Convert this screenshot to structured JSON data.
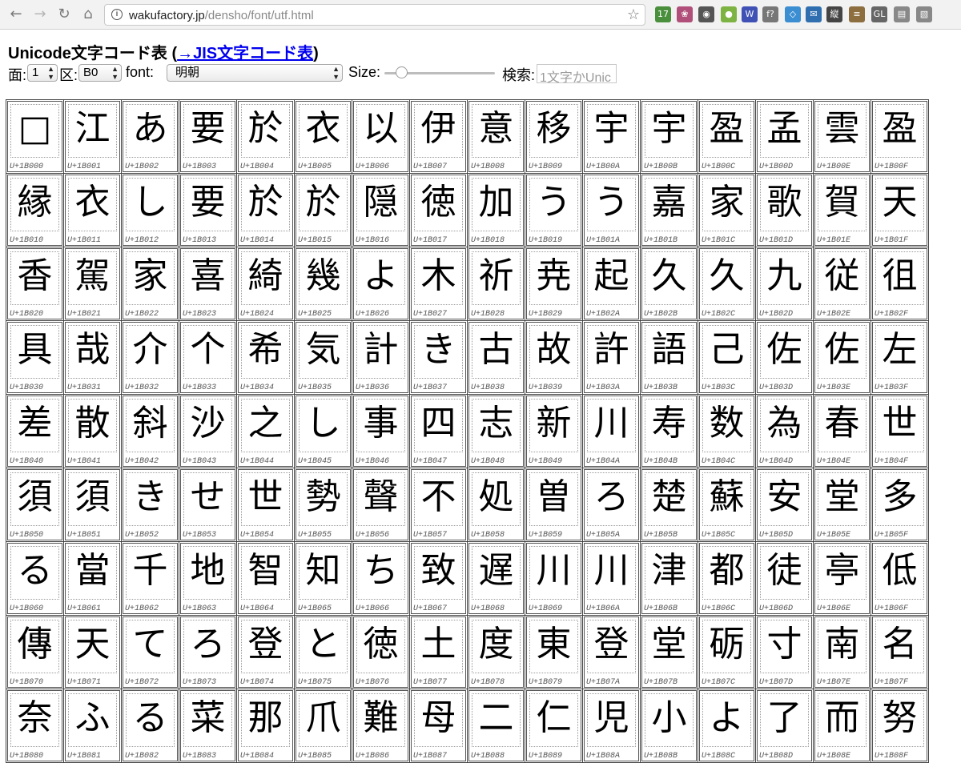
{
  "browser": {
    "url_host": "wakufactory.jp",
    "url_path": "/densho/font/utf.html",
    "back_icon": "←",
    "forward_icon": "→",
    "reload_icon": "↻",
    "home_icon": "⌂",
    "star_icon": "☆",
    "extensions": [
      {
        "name": "calendar-ext-icon",
        "glyph": "17",
        "color": "#4a8f3c"
      },
      {
        "name": "flower-ext-icon",
        "glyph": "❀",
        "color": "#b0507a"
      },
      {
        "name": "globe-ext-icon",
        "glyph": "◉",
        "color": "#555555"
      },
      {
        "name": "green-dot-ext-icon",
        "glyph": "●",
        "color": "#7cb342"
      },
      {
        "name": "we-ext-icon",
        "glyph": "W",
        "color": "#3f51b5"
      },
      {
        "name": "function-ext-icon",
        "glyph": "f?",
        "color": "#777777"
      },
      {
        "name": "diamond-ext-icon",
        "glyph": "◇",
        "color": "#3b8ed1"
      },
      {
        "name": "mail-ext-icon",
        "glyph": "✉",
        "color": "#2f6fb0"
      },
      {
        "name": "vertical-ext-icon",
        "glyph": "縦",
        "color": "#444444"
      },
      {
        "name": "page-ext-icon",
        "glyph": "≡",
        "color": "#8d6e3f"
      },
      {
        "name": "gl-ext-icon",
        "glyph": "GL",
        "color": "#666666"
      },
      {
        "name": "doc-ext-icon",
        "glyph": "▤",
        "color": "#888888"
      },
      {
        "name": "image-ext-icon",
        "glyph": "▧",
        "color": "#888888"
      }
    ]
  },
  "header": {
    "title": "Unicode文字コード表 (",
    "link": "→JIS文字コード表",
    "title_end": ")"
  },
  "controls": {
    "plane_label": "面:",
    "plane_value": "1",
    "block_label": "区:",
    "block_value": "B0",
    "font_label": "font:",
    "font_value": "明朝",
    "size_label": "Size:",
    "size_level": 0.1,
    "search_label": "検索:",
    "search_placeholder": "1文字かUnic"
  },
  "cells": [
    {
      "code": "U+1B000",
      "g": "□"
    },
    {
      "code": "U+1B001",
      "g": "江"
    },
    {
      "code": "U+1B002",
      "g": "あ"
    },
    {
      "code": "U+1B003",
      "g": "要"
    },
    {
      "code": "U+1B004",
      "g": "於"
    },
    {
      "code": "U+1B005",
      "g": "衣"
    },
    {
      "code": "U+1B006",
      "g": "以"
    },
    {
      "code": "U+1B007",
      "g": "伊"
    },
    {
      "code": "U+1B008",
      "g": "意"
    },
    {
      "code": "U+1B009",
      "g": "移"
    },
    {
      "code": "U+1B00A",
      "g": "宇"
    },
    {
      "code": "U+1B00B",
      "g": "宇"
    },
    {
      "code": "U+1B00C",
      "g": "盈"
    },
    {
      "code": "U+1B00D",
      "g": "孟"
    },
    {
      "code": "U+1B00E",
      "g": "雲"
    },
    {
      "code": "U+1B00F",
      "g": "盈"
    },
    {
      "code": "U+1B010",
      "g": "縁"
    },
    {
      "code": "U+1B011",
      "g": "衣"
    },
    {
      "code": "U+1B012",
      "g": "し"
    },
    {
      "code": "U+1B013",
      "g": "要"
    },
    {
      "code": "U+1B014",
      "g": "於"
    },
    {
      "code": "U+1B015",
      "g": "於"
    },
    {
      "code": "U+1B016",
      "g": "隠"
    },
    {
      "code": "U+1B017",
      "g": "徳"
    },
    {
      "code": "U+1B018",
      "g": "加"
    },
    {
      "code": "U+1B019",
      "g": "う"
    },
    {
      "code": "U+1B01A",
      "g": "う"
    },
    {
      "code": "U+1B01B",
      "g": "嘉"
    },
    {
      "code": "U+1B01C",
      "g": "家"
    },
    {
      "code": "U+1B01D",
      "g": "歌"
    },
    {
      "code": "U+1B01E",
      "g": "賀"
    },
    {
      "code": "U+1B01F",
      "g": "天"
    },
    {
      "code": "U+1B020",
      "g": "香"
    },
    {
      "code": "U+1B021",
      "g": "駕"
    },
    {
      "code": "U+1B022",
      "g": "家"
    },
    {
      "code": "U+1B023",
      "g": "喜"
    },
    {
      "code": "U+1B024",
      "g": "綺"
    },
    {
      "code": "U+1B025",
      "g": "幾"
    },
    {
      "code": "U+1B026",
      "g": "よ"
    },
    {
      "code": "U+1B027",
      "g": "木"
    },
    {
      "code": "U+1B028",
      "g": "祈"
    },
    {
      "code": "U+1B029",
      "g": "尭"
    },
    {
      "code": "U+1B02A",
      "g": "起"
    },
    {
      "code": "U+1B02B",
      "g": "久"
    },
    {
      "code": "U+1B02C",
      "g": "久"
    },
    {
      "code": "U+1B02D",
      "g": "九"
    },
    {
      "code": "U+1B02E",
      "g": "従"
    },
    {
      "code": "U+1B02F",
      "g": "徂"
    },
    {
      "code": "U+1B030",
      "g": "具"
    },
    {
      "code": "U+1B031",
      "g": "哉"
    },
    {
      "code": "U+1B032",
      "g": "介"
    },
    {
      "code": "U+1B033",
      "g": "个"
    },
    {
      "code": "U+1B034",
      "g": "希"
    },
    {
      "code": "U+1B035",
      "g": "気"
    },
    {
      "code": "U+1B036",
      "g": "計"
    },
    {
      "code": "U+1B037",
      "g": "き"
    },
    {
      "code": "U+1B038",
      "g": "古"
    },
    {
      "code": "U+1B039",
      "g": "故"
    },
    {
      "code": "U+1B03A",
      "g": "許"
    },
    {
      "code": "U+1B03B",
      "g": "語"
    },
    {
      "code": "U+1B03C",
      "g": "己"
    },
    {
      "code": "U+1B03D",
      "g": "佐"
    },
    {
      "code": "U+1B03E",
      "g": "佐"
    },
    {
      "code": "U+1B03F",
      "g": "左"
    },
    {
      "code": "U+1B040",
      "g": "差"
    },
    {
      "code": "U+1B041",
      "g": "散"
    },
    {
      "code": "U+1B042",
      "g": "斜"
    },
    {
      "code": "U+1B043",
      "g": "沙"
    },
    {
      "code": "U+1B044",
      "g": "之"
    },
    {
      "code": "U+1B045",
      "g": "し"
    },
    {
      "code": "U+1B046",
      "g": "事"
    },
    {
      "code": "U+1B047",
      "g": "四"
    },
    {
      "code": "U+1B048",
      "g": "志"
    },
    {
      "code": "U+1B049",
      "g": "新"
    },
    {
      "code": "U+1B04A",
      "g": "川"
    },
    {
      "code": "U+1B04B",
      "g": "寿"
    },
    {
      "code": "U+1B04C",
      "g": "数"
    },
    {
      "code": "U+1B04D",
      "g": "為"
    },
    {
      "code": "U+1B04E",
      "g": "春"
    },
    {
      "code": "U+1B04F",
      "g": "世"
    },
    {
      "code": "U+1B050",
      "g": "須"
    },
    {
      "code": "U+1B051",
      "g": "須"
    },
    {
      "code": "U+1B052",
      "g": "き"
    },
    {
      "code": "U+1B053",
      "g": "せ"
    },
    {
      "code": "U+1B054",
      "g": "世"
    },
    {
      "code": "U+1B055",
      "g": "勢"
    },
    {
      "code": "U+1B056",
      "g": "聲"
    },
    {
      "code": "U+1B057",
      "g": "不"
    },
    {
      "code": "U+1B058",
      "g": "処"
    },
    {
      "code": "U+1B059",
      "g": "曽"
    },
    {
      "code": "U+1B05A",
      "g": "ろ"
    },
    {
      "code": "U+1B05B",
      "g": "楚"
    },
    {
      "code": "U+1B05C",
      "g": "蘇"
    },
    {
      "code": "U+1B05D",
      "g": "安"
    },
    {
      "code": "U+1B05E",
      "g": "堂"
    },
    {
      "code": "U+1B05F",
      "g": "多"
    },
    {
      "code": "U+1B060",
      "g": "る"
    },
    {
      "code": "U+1B061",
      "g": "當"
    },
    {
      "code": "U+1B062",
      "g": "千"
    },
    {
      "code": "U+1B063",
      "g": "地"
    },
    {
      "code": "U+1B064",
      "g": "智"
    },
    {
      "code": "U+1B065",
      "g": "知"
    },
    {
      "code": "U+1B066",
      "g": "ち"
    },
    {
      "code": "U+1B067",
      "g": "致"
    },
    {
      "code": "U+1B068",
      "g": "遅"
    },
    {
      "code": "U+1B069",
      "g": "川"
    },
    {
      "code": "U+1B06A",
      "g": "川"
    },
    {
      "code": "U+1B06B",
      "g": "津"
    },
    {
      "code": "U+1B06C",
      "g": "都"
    },
    {
      "code": "U+1B06D",
      "g": "徒"
    },
    {
      "code": "U+1B06E",
      "g": "亭"
    },
    {
      "code": "U+1B06F",
      "g": "低"
    },
    {
      "code": "U+1B070",
      "g": "傳"
    },
    {
      "code": "U+1B071",
      "g": "天"
    },
    {
      "code": "U+1B072",
      "g": "て"
    },
    {
      "code": "U+1B073",
      "g": "ろ"
    },
    {
      "code": "U+1B074",
      "g": "登"
    },
    {
      "code": "U+1B075",
      "g": "と"
    },
    {
      "code": "U+1B076",
      "g": "徳"
    },
    {
      "code": "U+1B077",
      "g": "土"
    },
    {
      "code": "U+1B078",
      "g": "度"
    },
    {
      "code": "U+1B079",
      "g": "東"
    },
    {
      "code": "U+1B07A",
      "g": "登"
    },
    {
      "code": "U+1B07B",
      "g": "堂"
    },
    {
      "code": "U+1B07C",
      "g": "砺"
    },
    {
      "code": "U+1B07D",
      "g": "寸"
    },
    {
      "code": "U+1B07E",
      "g": "南"
    },
    {
      "code": "U+1B07F",
      "g": "名"
    },
    {
      "code": "U+1B080",
      "g": "奈"
    },
    {
      "code": "U+1B081",
      "g": "ふ"
    },
    {
      "code": "U+1B082",
      "g": "る"
    },
    {
      "code": "U+1B083",
      "g": "菜"
    },
    {
      "code": "U+1B084",
      "g": "那"
    },
    {
      "code": "U+1B085",
      "g": "爪"
    },
    {
      "code": "U+1B086",
      "g": "難"
    },
    {
      "code": "U+1B087",
      "g": "母"
    },
    {
      "code": "U+1B088",
      "g": "二"
    },
    {
      "code": "U+1B089",
      "g": "仁"
    },
    {
      "code": "U+1B08A",
      "g": "児"
    },
    {
      "code": "U+1B08B",
      "g": "小"
    },
    {
      "code": "U+1B08C",
      "g": "よ"
    },
    {
      "code": "U+1B08D",
      "g": "了"
    },
    {
      "code": "U+1B08E",
      "g": "而"
    },
    {
      "code": "U+1B08F",
      "g": "努"
    }
  ]
}
